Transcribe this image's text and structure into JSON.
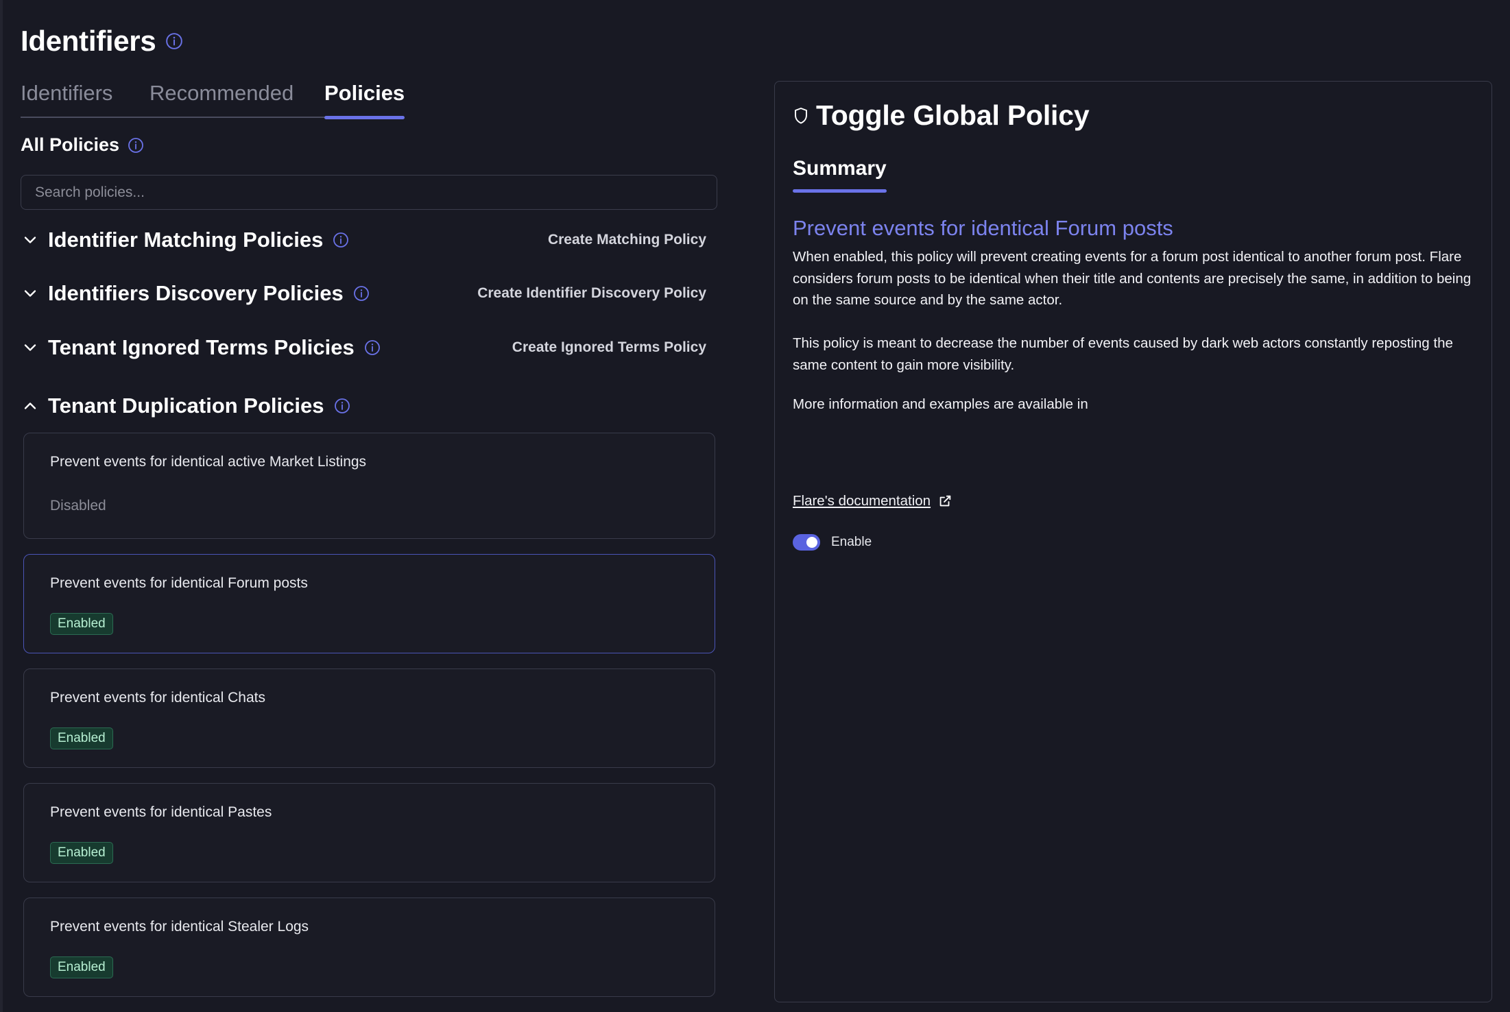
{
  "page": {
    "title": "Identifiers"
  },
  "tabs": [
    {
      "label": "Identifiers",
      "active": false
    },
    {
      "label": "Recommended",
      "active": false
    },
    {
      "label": "Policies",
      "active": true
    }
  ],
  "all_policies": {
    "label": "All Policies",
    "search_placeholder": "Search policies..."
  },
  "groups": [
    {
      "title": "Identifier Matching Policies",
      "action": "Create Matching Policy",
      "expanded": false
    },
    {
      "title": "Identifiers Discovery Policies",
      "action": "Create Identifier Discovery Policy",
      "expanded": false
    },
    {
      "title": "Tenant Ignored Terms Policies",
      "action": "Create Ignored Terms Policy",
      "expanded": false
    },
    {
      "title": "Tenant Duplication Policies",
      "action": "",
      "expanded": true
    }
  ],
  "policies": [
    {
      "title": "Prevent events for identical active Market Listings",
      "status": "Disabled"
    },
    {
      "title": "Prevent events for identical Forum posts",
      "status": "Enabled"
    },
    {
      "title": "Prevent events for identical Chats",
      "status": "Enabled"
    },
    {
      "title": "Prevent events for identical Pastes",
      "status": "Enabled"
    },
    {
      "title": "Prevent events for identical Stealer Logs",
      "status": "Enabled"
    }
  ],
  "panel": {
    "title": "Toggle Global Policy",
    "summary_tab": "Summary",
    "policy_name": "Prevent events for identical Forum posts",
    "description_1": "When enabled, this policy will prevent creating events for a forum post identical to another forum post. Flare considers forum posts to be identical when their title and contents are precisely the same, in addition to being on the same source and by the same actor.",
    "description_2": "This policy is meant to decrease the number of events caused by dark web actors constantly reposting the same content to gain more visibility.",
    "description_3": "More information and examples are available in",
    "doc_link": "Flare's documentation",
    "toggle_label": "Enable",
    "toggle_on": true
  },
  "colors": {
    "background": "#181923",
    "accent": "#6a72e8",
    "enabled_badge_bg": "#173b2f",
    "enabled_badge_text": "#b7f0d3"
  }
}
